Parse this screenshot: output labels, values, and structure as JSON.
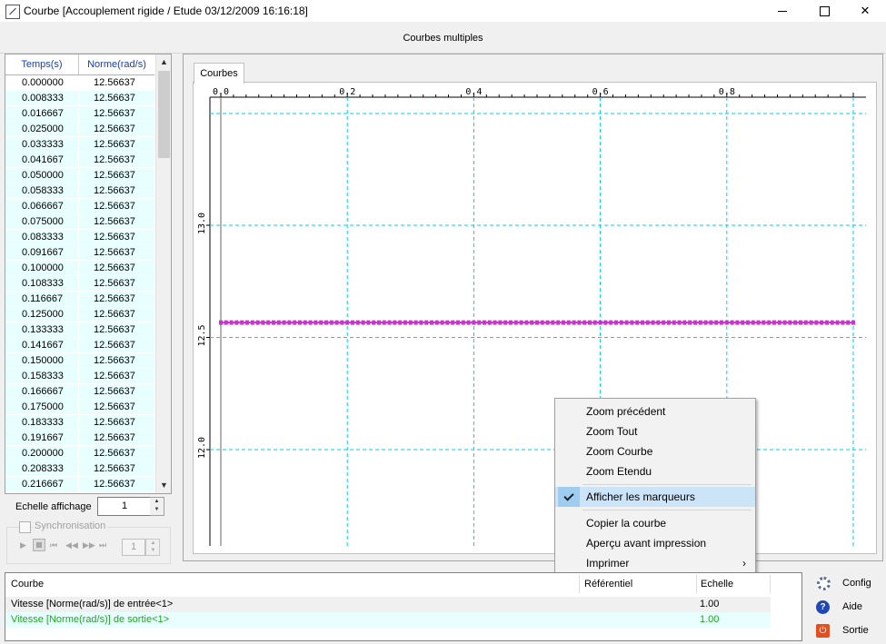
{
  "window": {
    "title": "Courbe [Accouplement rigide / Etude 03/12/2009 16:16:18]",
    "controls": {
      "minimize_icon": "minimize-icon",
      "maximize_icon": "maximize-icon",
      "close_glyph": "✕"
    }
  },
  "header": {
    "title": "Courbes multiples"
  },
  "table": {
    "columns": [
      "Temps(s)",
      "Norme(rad/s)"
    ],
    "rows": [
      [
        "0.000000",
        "12.56637"
      ],
      [
        "0.008333",
        "12.56637"
      ],
      [
        "0.016667",
        "12.56637"
      ],
      [
        "0.025000",
        "12.56637"
      ],
      [
        "0.033333",
        "12.56637"
      ],
      [
        "0.041667",
        "12.56637"
      ],
      [
        "0.050000",
        "12.56637"
      ],
      [
        "0.058333",
        "12.56637"
      ],
      [
        "0.066667",
        "12.56637"
      ],
      [
        "0.075000",
        "12.56637"
      ],
      [
        "0.083333",
        "12.56637"
      ],
      [
        "0.091667",
        "12.56637"
      ],
      [
        "0.100000",
        "12.56637"
      ],
      [
        "0.108333",
        "12.56637"
      ],
      [
        "0.116667",
        "12.56637"
      ],
      [
        "0.125000",
        "12.56637"
      ],
      [
        "0.133333",
        "12.56637"
      ],
      [
        "0.141667",
        "12.56637"
      ],
      [
        "0.150000",
        "12.56637"
      ],
      [
        "0.158333",
        "12.56637"
      ],
      [
        "0.166667",
        "12.56637"
      ],
      [
        "0.175000",
        "12.56637"
      ],
      [
        "0.183333",
        "12.56637"
      ],
      [
        "0.191667",
        "12.56637"
      ],
      [
        "0.200000",
        "12.56637"
      ],
      [
        "0.208333",
        "12.56637"
      ],
      [
        "0.216667",
        "12.56637"
      ]
    ],
    "scroll_up": "▲",
    "scroll_down": "▼"
  },
  "scale": {
    "label": "Echelle affichage",
    "value": "1"
  },
  "sync": {
    "label": "Synchronisation",
    "value": "1",
    "play": "▶",
    "first": "⏮",
    "prev": "◀◀",
    "next": "▶▶",
    "last": "⏭"
  },
  "tab": {
    "label": "Courbes"
  },
  "chart_data": {
    "type": "line",
    "xlim": [
      0,
      1.0
    ],
    "ylim": [
      11.75,
      13.25
    ],
    "x_ticks": [
      "0.0",
      "0.2",
      "0.4",
      "0.6",
      "0.8"
    ],
    "y_ticks": [
      "13.0",
      "12.5",
      "12.0"
    ],
    "grid": true,
    "markers": true,
    "color": "#cc33cc",
    "series": [
      {
        "x_start": 0.0,
        "x_end": 1.0,
        "x_step": 0.008333,
        "y": 12.56637
      }
    ]
  },
  "context_menu": {
    "items": [
      {
        "label": "Zoom précédent"
      },
      {
        "label": "Zoom Tout"
      },
      {
        "label": "Zoom Courbe"
      },
      {
        "label": "Zoom Etendu"
      },
      {
        "label": "Afficher les marqueurs",
        "checked": true
      },
      {
        "label": "Copier la courbe"
      },
      {
        "label": "Aperçu avant impression"
      },
      {
        "label": "Imprimer",
        "submenu_arrow": "›"
      }
    ]
  },
  "curves": {
    "columns": [
      "Courbe",
      "Référentiel",
      "Echelle"
    ],
    "rows": [
      {
        "name": "Vitesse [Norme(rad/s)] de entrée<1>",
        "ref": "",
        "scale": "1.00"
      },
      {
        "name": "Vitesse [Norme(rad/s)] de sortie<1>",
        "ref": "",
        "scale": "1.00"
      }
    ]
  },
  "side_buttons": {
    "config": "Config",
    "help": "Aide",
    "help_glyph": "?",
    "exit": "Sortie",
    "exit_glyph": "⏻"
  }
}
